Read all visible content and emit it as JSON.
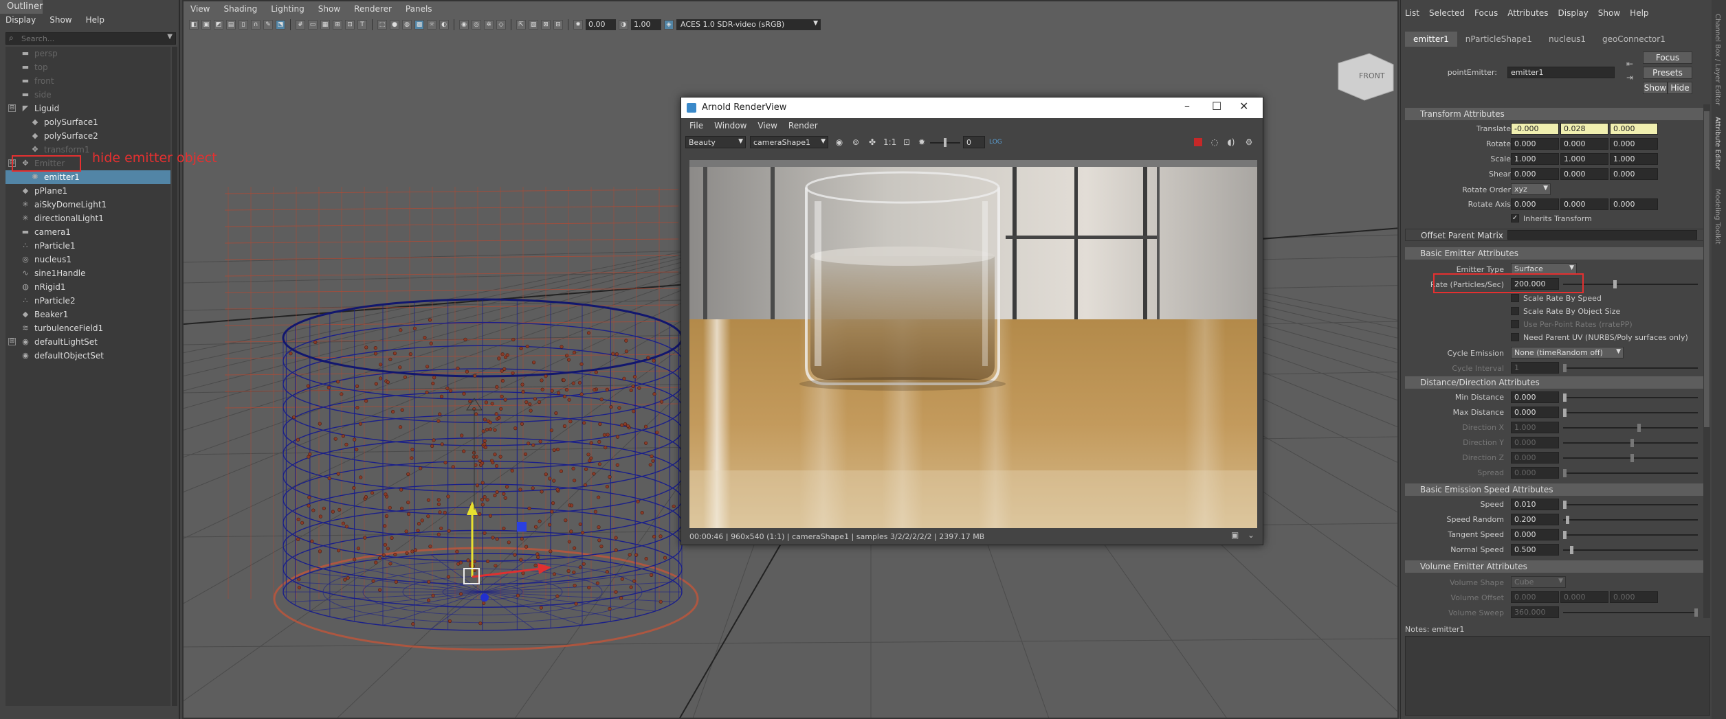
{
  "outliner": {
    "title": "Outliner",
    "menu": [
      "Display",
      "Show",
      "Help"
    ],
    "search_placeholder": "Search...",
    "items": [
      {
        "label": "persp",
        "icon": "camera-icon",
        "dim": true
      },
      {
        "label": "top",
        "icon": "camera-icon",
        "dim": true
      },
      {
        "label": "front",
        "icon": "camera-icon",
        "dim": true
      },
      {
        "label": "side",
        "icon": "camera-icon",
        "dim": true
      },
      {
        "label": "Liguid",
        "icon": "group-icon",
        "dim": false
      },
      {
        "label": "polySurface1",
        "icon": "mesh-icon",
        "dim": false
      },
      {
        "label": "polySurface2",
        "icon": "mesh-icon",
        "dim": false
      },
      {
        "label": "transform1",
        "icon": "transform-icon",
        "dim": true
      },
      {
        "label": "Emitter",
        "icon": "transform-icon",
        "dim": true
      },
      {
        "label": "emitter1",
        "icon": "emitter-icon",
        "dim": false
      },
      {
        "label": "pPlane1",
        "icon": "mesh-icon",
        "dim": false
      },
      {
        "label": "aiSkyDomeLight1",
        "icon": "light-icon",
        "dim": false
      },
      {
        "label": "directionalLight1",
        "icon": "light-icon",
        "dim": false
      },
      {
        "label": "camera1",
        "icon": "camera-icon",
        "dim": false
      },
      {
        "label": "nParticle1",
        "icon": "particle-icon",
        "dim": false
      },
      {
        "label": "nucleus1",
        "icon": "nucleus-icon",
        "dim": false
      },
      {
        "label": "sine1Handle",
        "icon": "deformer-icon",
        "dim": false
      },
      {
        "label": "nRigid1",
        "icon": "rigid-icon",
        "dim": false
      },
      {
        "label": "nParticle2",
        "icon": "particle-icon",
        "dim": false
      },
      {
        "label": "Beaker1",
        "icon": "mesh-icon",
        "dim": false
      },
      {
        "label": "turbulenceField1",
        "icon": "field-icon",
        "dim": false
      },
      {
        "label": "defaultLightSet",
        "icon": "set-icon",
        "dim": false
      },
      {
        "label": "defaultObjectSet",
        "icon": "set-icon",
        "dim": false
      }
    ]
  },
  "annotation": {
    "text": "hide emitter object",
    "color": "#e53030"
  },
  "viewport": {
    "menu": [
      "View",
      "Shading",
      "Lighting",
      "Show",
      "Renderer",
      "Panels"
    ],
    "exposure": "0.00",
    "gamma": "1.00",
    "color_space": "ACES 1.0 SDR-video (sRGB)",
    "view_cube": "FRONT"
  },
  "renderview": {
    "title": "Arnold RenderView",
    "menu": [
      "File",
      "Window",
      "View",
      "Render"
    ],
    "aov": "Beauty",
    "camera": "cameraShape1",
    "ratio": "1:1",
    "exposure": "0",
    "status": "00:00:46 | 960x540 (1:1) | cameraShape1  | samples 3/2/2/2/2/2 | 2397.17 MB"
  },
  "attribute_editor": {
    "menu": [
      "List",
      "Selected",
      "Focus",
      "Attributes",
      "Display",
      "Show",
      "Help"
    ],
    "tabs": [
      "emitter1",
      "nParticleShape1",
      "nucleus1",
      "geoConnector1"
    ],
    "buttons": {
      "focus": "Focus",
      "presets": "Presets",
      "show": "Show",
      "hide": "Hide"
    },
    "node_label": "pointEmitter:",
    "node_name": "emitter1",
    "sections": {
      "transform": "Transform Attributes",
      "offset": "Offset Parent Matrix",
      "basic_emitter": "Basic Emitter Attributes",
      "distance": "Distance/Direction Attributes",
      "speed": "Basic Emission Speed Attributes",
      "volume": "Volume Emitter Attributes"
    },
    "transform": {
      "translate": {
        "label": "Translate",
        "values": [
          "-0.000",
          "0.028",
          "0.000"
        ]
      },
      "rotate": {
        "label": "Rotate",
        "values": [
          "0.000",
          "0.000",
          "0.000"
        ]
      },
      "scale": {
        "label": "Scale",
        "values": [
          "1.000",
          "1.000",
          "1.000"
        ]
      },
      "shear": {
        "label": "Shear",
        "values": [
          "0.000",
          "0.000",
          "0.000"
        ]
      },
      "rotate_order": {
        "label": "Rotate Order",
        "value": "xyz"
      },
      "rotate_axis": {
        "label": "Rotate Axis",
        "values": [
          "0.000",
          "0.000",
          "0.000"
        ]
      },
      "inherits": "Inherits Transform"
    },
    "basic": {
      "emitter_type_label": "Emitter Type",
      "emitter_type": "Surface",
      "rate_label": "Rate (Particles/Sec)",
      "rate": "200.000",
      "checks": [
        "Scale Rate By Speed",
        "Scale Rate By Object Size",
        "Use Per-Point Rates (rratePP)",
        "Need Parent UV (NURBS/Poly surfaces only)"
      ],
      "cycle_emission_label": "Cycle Emission",
      "cycle_emission": "None (timeRandom off)",
      "cycle_interval_label": "Cycle Interval",
      "cycle_interval": "1"
    },
    "distance": [
      {
        "label": "Min Distance",
        "value": "0.000",
        "dim": false,
        "knob": 0.0
      },
      {
        "label": "Max Distance",
        "value": "0.000",
        "dim": false,
        "knob": 0.0
      },
      {
        "label": "Direction X",
        "value": "1.000",
        "dim": true,
        "knob": 0.55
      },
      {
        "label": "Direction Y",
        "value": "0.000",
        "dim": true,
        "knob": 0.5
      },
      {
        "label": "Direction Z",
        "value": "0.000",
        "dim": true,
        "knob": 0.5
      },
      {
        "label": "Spread",
        "value": "0.000",
        "dim": true,
        "knob": 0.0
      }
    ],
    "speed": [
      {
        "label": "Speed",
        "value": "0.010",
        "knob": 0.0
      },
      {
        "label": "Speed Random",
        "value": "0.200",
        "knob": 0.02
      },
      {
        "label": "Tangent Speed",
        "value": "0.000",
        "knob": 0.0
      },
      {
        "label": "Normal Speed",
        "value": "0.500",
        "knob": 0.05
      }
    ],
    "volume": {
      "shape_label": "Volume Shape",
      "shape": "Cube",
      "offset_label": "Volume Offset",
      "offset": [
        "0.000",
        "0.000",
        "0.000"
      ],
      "sweep_label": "Volume Sweep",
      "sweep": "360.000"
    },
    "notes": "Notes:  emitter1",
    "side_tabs": [
      "Channel Box / Layer Editor",
      "Attribute Editor",
      "Modeling Toolkit"
    ]
  }
}
